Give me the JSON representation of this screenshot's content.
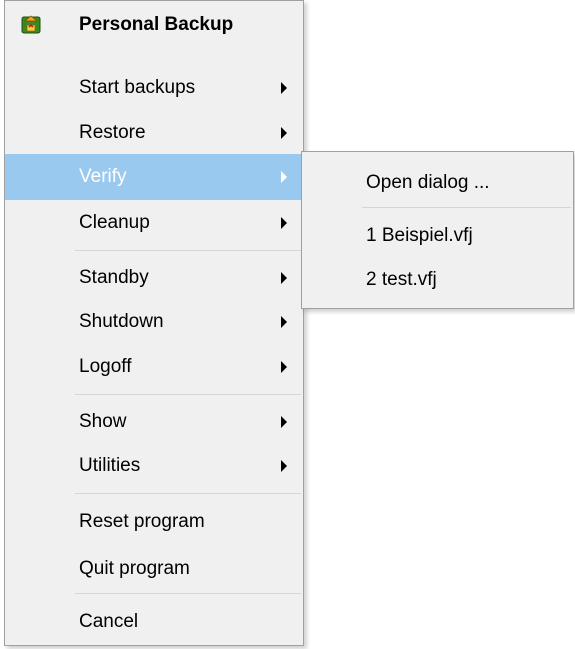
{
  "menu": {
    "title": "Personal Backup",
    "app_icon": "personal-backup-app-icon",
    "items": [
      {
        "label": "Start backups",
        "submenu": true
      },
      {
        "label": "Restore",
        "submenu": true
      },
      {
        "label": "Verify",
        "submenu": true,
        "selected": true
      },
      {
        "label": "Cleanup",
        "submenu": true
      },
      {
        "label": "Standby",
        "submenu": true
      },
      {
        "label": "Shutdown",
        "submenu": true
      },
      {
        "label": "Logoff",
        "submenu": true
      },
      {
        "label": "Show",
        "submenu": true
      },
      {
        "label": "Utilities",
        "submenu": true
      },
      {
        "label": "Reset program",
        "submenu": false
      },
      {
        "label": "Quit program",
        "submenu": false
      },
      {
        "label": "Cancel",
        "submenu": false
      }
    ]
  },
  "submenu": {
    "items": [
      {
        "label": "Open dialog ..."
      },
      {
        "label": "1 Beispiel.vfj"
      },
      {
        "label": "2 test.vfj"
      }
    ]
  },
  "colors": {
    "menu_bg": "#f0f0f0",
    "highlight": "#99c9ef",
    "separator": "#d5d5d5",
    "border": "#a0a0a0"
  }
}
